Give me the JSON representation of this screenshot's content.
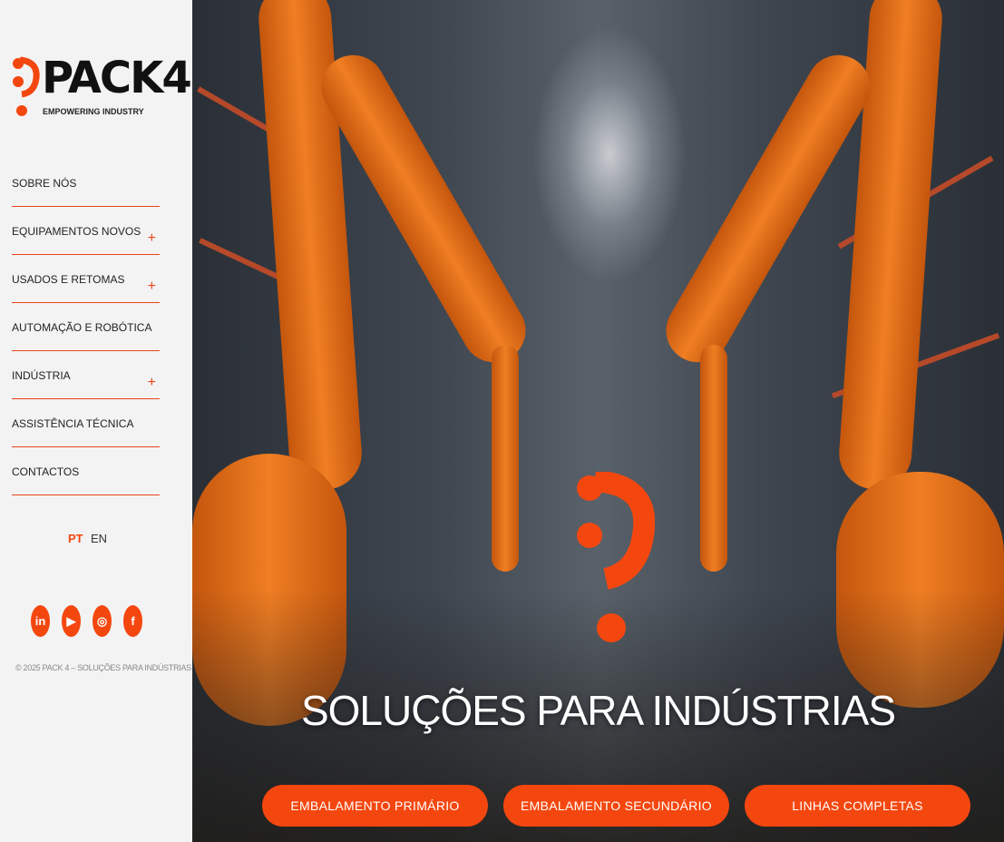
{
  "brand": {
    "name": "PACK4",
    "tagline": "EMPOWERING INDUSTRY",
    "accent": "#f4470f"
  },
  "nav": [
    {
      "label": "SOBRE NÓS",
      "expandable": false
    },
    {
      "label": "EQUIPAMENTOS NOVOS",
      "expandable": true
    },
    {
      "label": "USADOS E RETOMAS",
      "expandable": true
    },
    {
      "label": "AUTOMAÇÃO E ROBÓTICA",
      "expandable": false
    },
    {
      "label": "INDÚSTRIA",
      "expandable": true
    },
    {
      "label": "ASSISTÊNCIA TÉCNICA",
      "expandable": false
    },
    {
      "label": "CONTACTOS",
      "expandable": false
    }
  ],
  "expand_symbol": "+",
  "languages": {
    "active": "PT",
    "other": "EN"
  },
  "social": [
    {
      "icon": "linkedin-icon",
      "glyph": "in"
    },
    {
      "icon": "youtube-icon",
      "glyph": "▶"
    },
    {
      "icon": "instagram-icon",
      "glyph": "◎"
    },
    {
      "icon": "facebook-icon",
      "glyph": "f"
    }
  ],
  "copyright": "© 2025 PACK 4 – SOLUÇÕES PARA INDÚSTRIAS",
  "hero": {
    "title": "SOLUÇÕES PARA INDÚSTRIAS",
    "buttons": [
      "EMBALAMENTO PRIMÁRIO",
      "EMBALAMENTO SECUNDÁRIO",
      "LINHAS COMPLETAS"
    ]
  }
}
